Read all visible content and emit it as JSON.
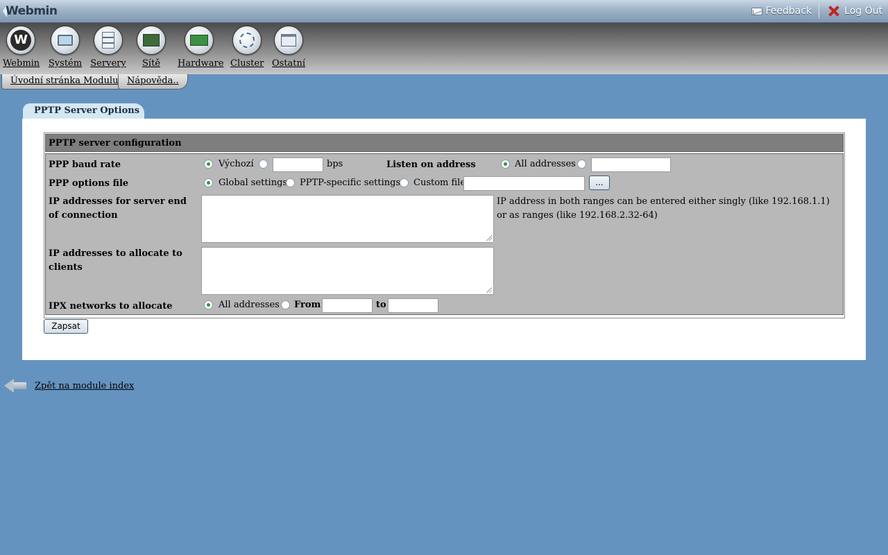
{
  "topbar": {
    "logo": "Webmin",
    "feedback": "Feedback",
    "logout": "Log Out"
  },
  "categories": [
    {
      "label": "Webmin",
      "icon": "webmin-icon"
    },
    {
      "label": "Systém",
      "icon": "system-icon"
    },
    {
      "label": "Servery",
      "icon": "servers-icon"
    },
    {
      "label": "Sítě",
      "icon": "network-icon"
    },
    {
      "label": "Hardware",
      "icon": "hardware-icon"
    },
    {
      "label": "Cluster",
      "icon": "cluster-icon"
    },
    {
      "label": "Ostatní",
      "icon": "others-icon"
    }
  ],
  "module_tabs": [
    "Úvodní stránka Modulu",
    "Nápověda.."
  ],
  "panel": {
    "tab": "PPTP Server Options",
    "section_title": "PPTP server configuration",
    "baud": {
      "label": "PPP baud rate",
      "default_option": "Výchozí",
      "value": "",
      "unit": "bps",
      "selected": "default"
    },
    "listen": {
      "label": "Listen on address",
      "all_option": "All addresses",
      "value": "",
      "selected": "all"
    },
    "options_file": {
      "label": "PPP options file",
      "options": [
        "Global settings",
        "PPTP-specific settings",
        "Custom file"
      ],
      "selected": "Global settings",
      "custom_value": "",
      "browse_label": "..."
    },
    "server_ips": {
      "label": "IP addresses for server end of connection",
      "value": "",
      "note": "IP address in both ranges can be entered either singly (like 192.168.1.1) or as ranges (like 192.168.2.32-64)"
    },
    "client_ips": {
      "label": "IP addresses to allocate to clients",
      "value": ""
    },
    "ipx": {
      "label": "IPX networks to allocate",
      "all_option": "All addresses",
      "from_label": "From",
      "to_label": "to",
      "from_value": "",
      "to_value": "",
      "selected": "all"
    },
    "save_button": "Zapsat"
  },
  "back_link": "Zpět na module index",
  "colors": {
    "background": "#6593c0",
    "header_bar": "#7e7e7e",
    "panel_tab": "#d4e7f4",
    "radio_selected": "#2a9b36"
  }
}
